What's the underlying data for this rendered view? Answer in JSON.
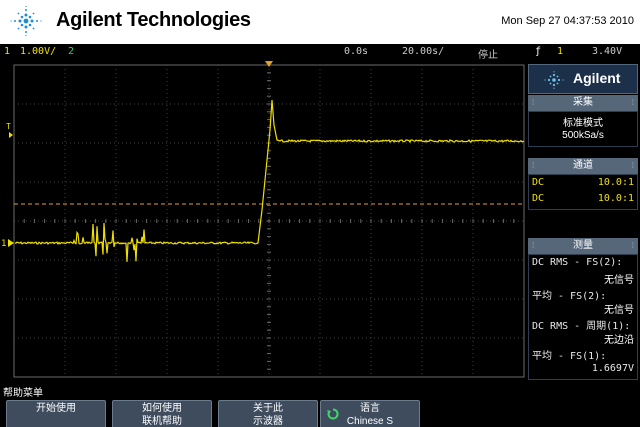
{
  "header": {
    "brand": "Agilent Technologies",
    "datetime": "Mon Sep 27 04:37:53 2010"
  },
  "status_bar": {
    "channel1_num": "1",
    "channel1_scale": "1.00V/",
    "channel2_num": "2",
    "time_offset": "0.0s",
    "timebase": "20.00s/",
    "run_state": "停止",
    "trigger_icon": "ƒ",
    "trigger_channel": "1",
    "trigger_level": "3.40V"
  },
  "scope": {
    "trigger_marker": "T",
    "channel_marker": "1",
    "colors": {
      "trace": "#f0e000",
      "grid": "#4a4a4a",
      "cursor": "#e0a030"
    }
  },
  "panel": {
    "logo_text": "Agilent",
    "acquire": {
      "title": "采集",
      "mode": "标准模式",
      "rate": "500kSa/s"
    },
    "channels": {
      "title": "通道",
      "rows": [
        {
          "coupling": "DC",
          "probe": "10.0:1"
        },
        {
          "coupling": "DC",
          "probe": "10.0:1"
        }
      ]
    },
    "measure": {
      "title": "测量",
      "items": [
        {
          "label": "DC RMS - FS(2):",
          "value": "无信号"
        },
        {
          "label": "平均 - FS(2):",
          "value": "无信号"
        },
        {
          "label": "DC RMS - 周期(1):",
          "value": "无边沿"
        },
        {
          "label": "平均 - FS(1):",
          "value": "1.6697V"
        }
      ]
    }
  },
  "footer": {
    "menu_title": "帮助菜单",
    "softkeys": [
      {
        "line1": "开始使用",
        "line2": ""
      },
      {
        "line1": "如何使用",
        "line2": "联机帮助"
      },
      {
        "line1": "关于此",
        "line2": "示波器"
      },
      {
        "line1": "语言",
        "line2": "Chinese S"
      }
    ]
  }
}
